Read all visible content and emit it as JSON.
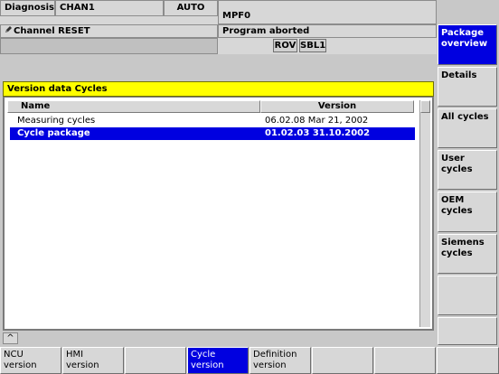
{
  "header": {
    "mode": "Diagnosis",
    "channel": "CHAN1",
    "op_mode": "AUTO",
    "program": "MPF0",
    "channel_status": "Channel RESET",
    "program_status": "Program aborted",
    "flag_rov": "ROV",
    "flag_sbl": "SBL1"
  },
  "panel": {
    "title": "Version data Cycles",
    "columns": {
      "name": "Name",
      "version": "Version"
    },
    "rows": [
      {
        "name": "Measuring cycles",
        "version": "06.02.08  Mar 21, 2002",
        "selected": false
      },
      {
        "name": "Cycle package",
        "version": "01.02.03  31.10.2002",
        "selected": true
      }
    ]
  },
  "recall_glyph": "^",
  "vertical_softkeys": [
    {
      "label": "Package\noverview",
      "active": true
    },
    {
      "label": "Details",
      "active": false
    },
    {
      "label": "All cycles",
      "active": false
    },
    {
      "label": "User\ncycles",
      "active": false
    },
    {
      "label": "OEM\ncycles",
      "active": false
    },
    {
      "label": "Siemens\ncycles",
      "active": false
    },
    {
      "label": "",
      "active": false
    },
    {
      "label": "",
      "active": false
    }
  ],
  "horizontal_softkeys": [
    {
      "label": "NCU\nversion",
      "active": false
    },
    {
      "label": "HMI\nversion",
      "active": false
    },
    {
      "label": "",
      "active": false
    },
    {
      "label": "Cycle\nversion",
      "active": true
    },
    {
      "label": "Definition\nversion",
      "active": false
    },
    {
      "label": "",
      "active": false
    },
    {
      "label": "",
      "active": false
    },
    {
      "label": "",
      "active": false
    }
  ],
  "colors": {
    "selection": "#0000e0",
    "title_bar": "#ffff00",
    "background": "#c8c8c8"
  }
}
